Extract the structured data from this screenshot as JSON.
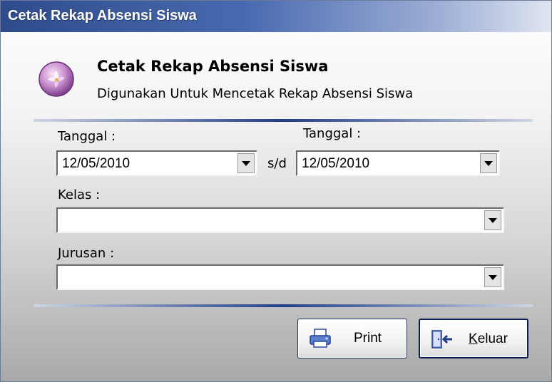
{
  "window": {
    "title": "Cetak Rekap Absensi Siswa"
  },
  "header": {
    "title": "Cetak Rekap Absensi Siswa",
    "subtitle": "Digunakan Untuk Mencetak Rekap Absensi Siswa",
    "icon": "flower-orb-icon"
  },
  "form": {
    "date_from": {
      "label": "Tanggal :",
      "value": "12/05/2010"
    },
    "range_separator": "s/d",
    "date_to": {
      "label": "Tanggal :",
      "value": "12/05/2010"
    },
    "kelas": {
      "label": "Kelas :",
      "value": ""
    },
    "jurusan": {
      "label": "Jurusan :",
      "value": ""
    }
  },
  "buttons": {
    "print": {
      "label": "Print",
      "icon": "printer-icon"
    },
    "keluar": {
      "label": "Keluar",
      "icon": "exit-door-icon"
    }
  },
  "colors": {
    "accent": "#1f3d8a",
    "titlebar": "#2e4c8c"
  }
}
